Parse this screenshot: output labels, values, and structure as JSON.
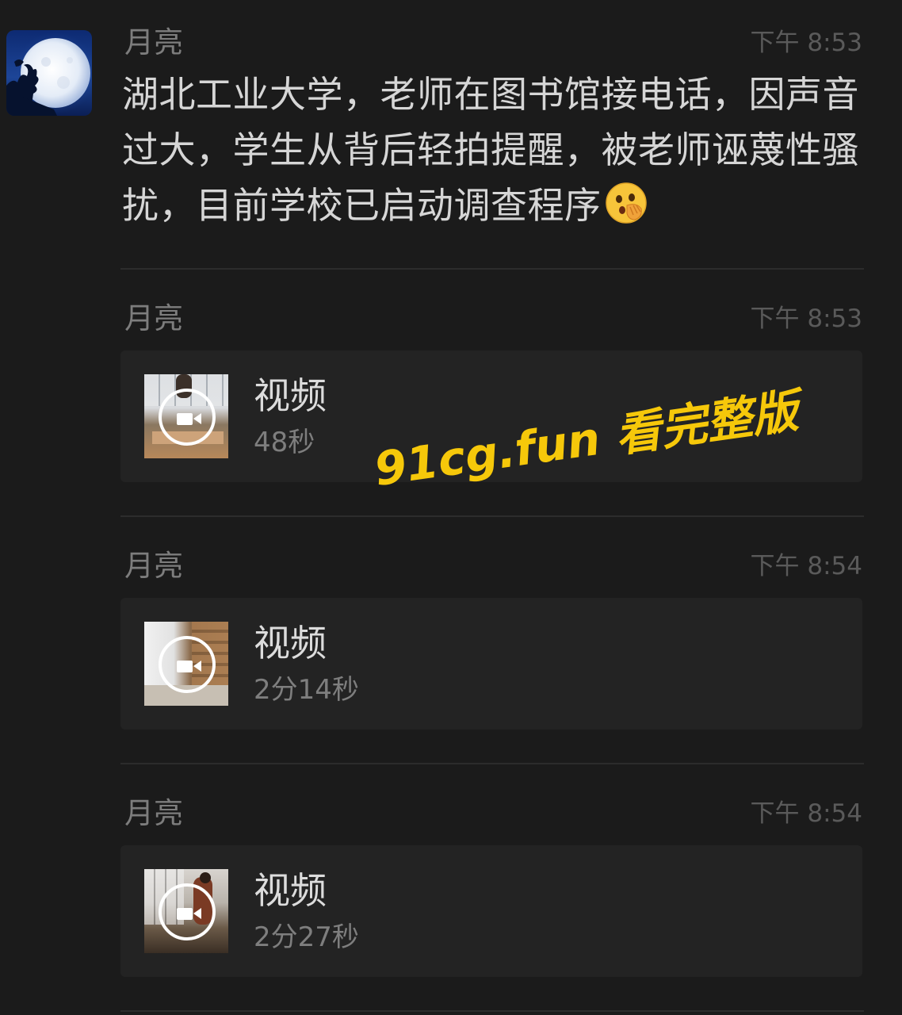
{
  "messages": [
    {
      "sender": "月亮",
      "time": "下午 8:53",
      "text": "湖北工业大学，老师在图书馆接电话，因声音过大，学生从背后轻拍提醒，被老师诬蔑性骚扰，目前学校已启动调查程序",
      "emoji": "face-with-open-eyes-and-hand-over-mouth-emoji"
    },
    {
      "sender": "月亮",
      "time": "下午 8:53",
      "video": {
        "label": "视频",
        "duration": "48秒"
      }
    },
    {
      "sender": "月亮",
      "time": "下午 8:54",
      "video": {
        "label": "视频",
        "duration": "2分14秒"
      }
    },
    {
      "sender": "月亮",
      "time": "下午 8:54",
      "video": {
        "label": "视频",
        "duration": "2分27秒"
      }
    }
  ],
  "watermark": "91cg.fun 看完整版",
  "colors": {
    "background": "#1b1b1b",
    "card": "#232323",
    "watermark": "#f6c80a"
  }
}
